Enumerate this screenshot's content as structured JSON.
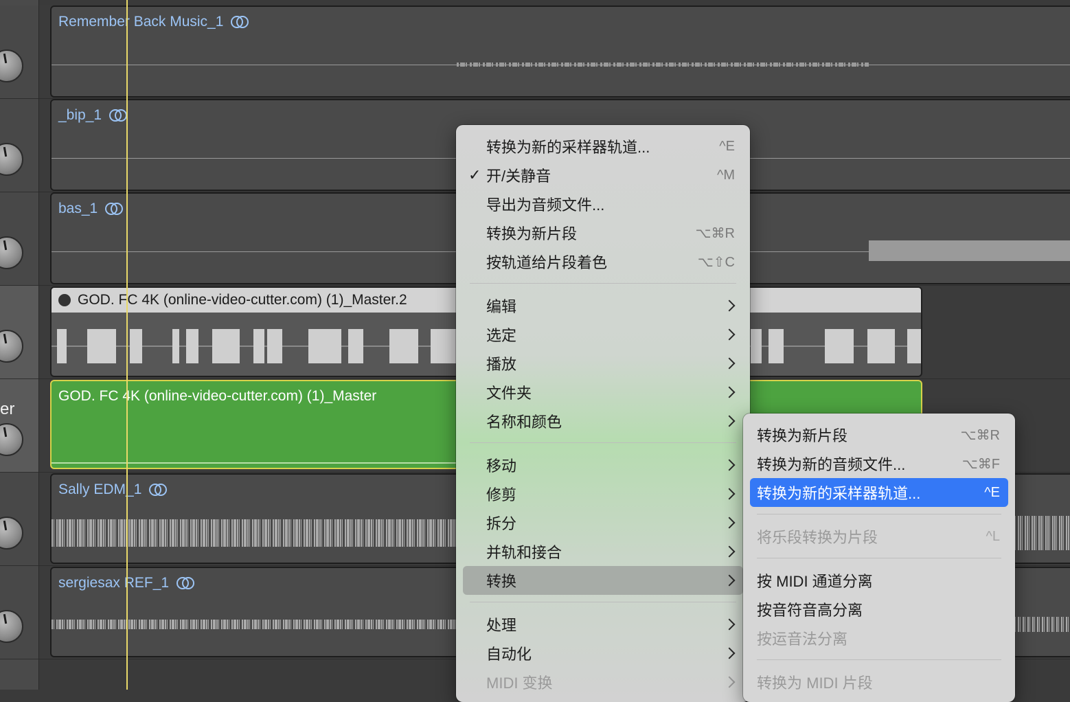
{
  "tracks": [
    {
      "region": "Remember Back Music_1",
      "looped": true
    },
    {
      "region": "_bip_1",
      "looped": true
    },
    {
      "region": "bas_1",
      "looped": true
    },
    {
      "region": "GOD. FC 4K (online-video-cutter.com) (1)_Master.2",
      "looped": false
    },
    {
      "region": "GOD. FC 4K (online-video-cutter.com) (1)_Master",
      "looped": false
    },
    {
      "region": "Sally EDM_1",
      "looped": true
    },
    {
      "region": "sergiesax REF_1",
      "looped": true
    }
  ],
  "track_header_fragment": "er",
  "colors": {
    "selected_region": "#4da340",
    "selected_border": "#d8d24a",
    "highlight": "#3478f6",
    "playhead": "#e9d96a"
  },
  "context_menu": {
    "items": [
      {
        "label": "转换为新的采样器轨道...",
        "shortcut": "^E"
      },
      {
        "label": "开/关静音",
        "shortcut": "^M",
        "checked": true
      },
      {
        "label": "导出为音频文件...",
        "shortcut": ""
      },
      {
        "label": "转换为新片段",
        "shortcut": "⌥⌘R"
      },
      {
        "label": "按轨道给片段着色",
        "shortcut": "⌥⇧C"
      },
      {
        "label": "编辑",
        "submenu": true
      },
      {
        "label": "选定",
        "submenu": true
      },
      {
        "label": "播放",
        "submenu": true
      },
      {
        "label": "文件夹",
        "submenu": true
      },
      {
        "label": "名称和颜色",
        "submenu": true
      },
      {
        "label": "移动",
        "submenu": true
      },
      {
        "label": "修剪",
        "submenu": true
      },
      {
        "label": "拆分",
        "submenu": true
      },
      {
        "label": "并轨和接合",
        "submenu": true
      },
      {
        "label": "转换",
        "submenu": true,
        "hovered": true
      },
      {
        "label": "处理",
        "submenu": true
      },
      {
        "label": "自动化",
        "submenu": true
      },
      {
        "label": "MIDI 变换",
        "submenu": true,
        "disabled": true
      }
    ]
  },
  "submenu": {
    "items": [
      {
        "label": "转换为新片段",
        "shortcut": "⌥⌘R"
      },
      {
        "label": "转换为新的音频文件...",
        "shortcut": "⌥⌘F"
      },
      {
        "label": "转换为新的采样器轨道...",
        "shortcut": "^E",
        "highlighted": true
      },
      {
        "label": "将乐段转换为片段",
        "shortcut": "^L",
        "disabled": true
      },
      {
        "label": "按 MIDI 通道分离",
        "shortcut": ""
      },
      {
        "label": "按音符音高分离",
        "shortcut": ""
      },
      {
        "label": "按运音法分离",
        "shortcut": "",
        "disabled": true
      },
      {
        "label": "转换为 MIDI 片段",
        "shortcut": "",
        "disabled": true
      }
    ]
  }
}
